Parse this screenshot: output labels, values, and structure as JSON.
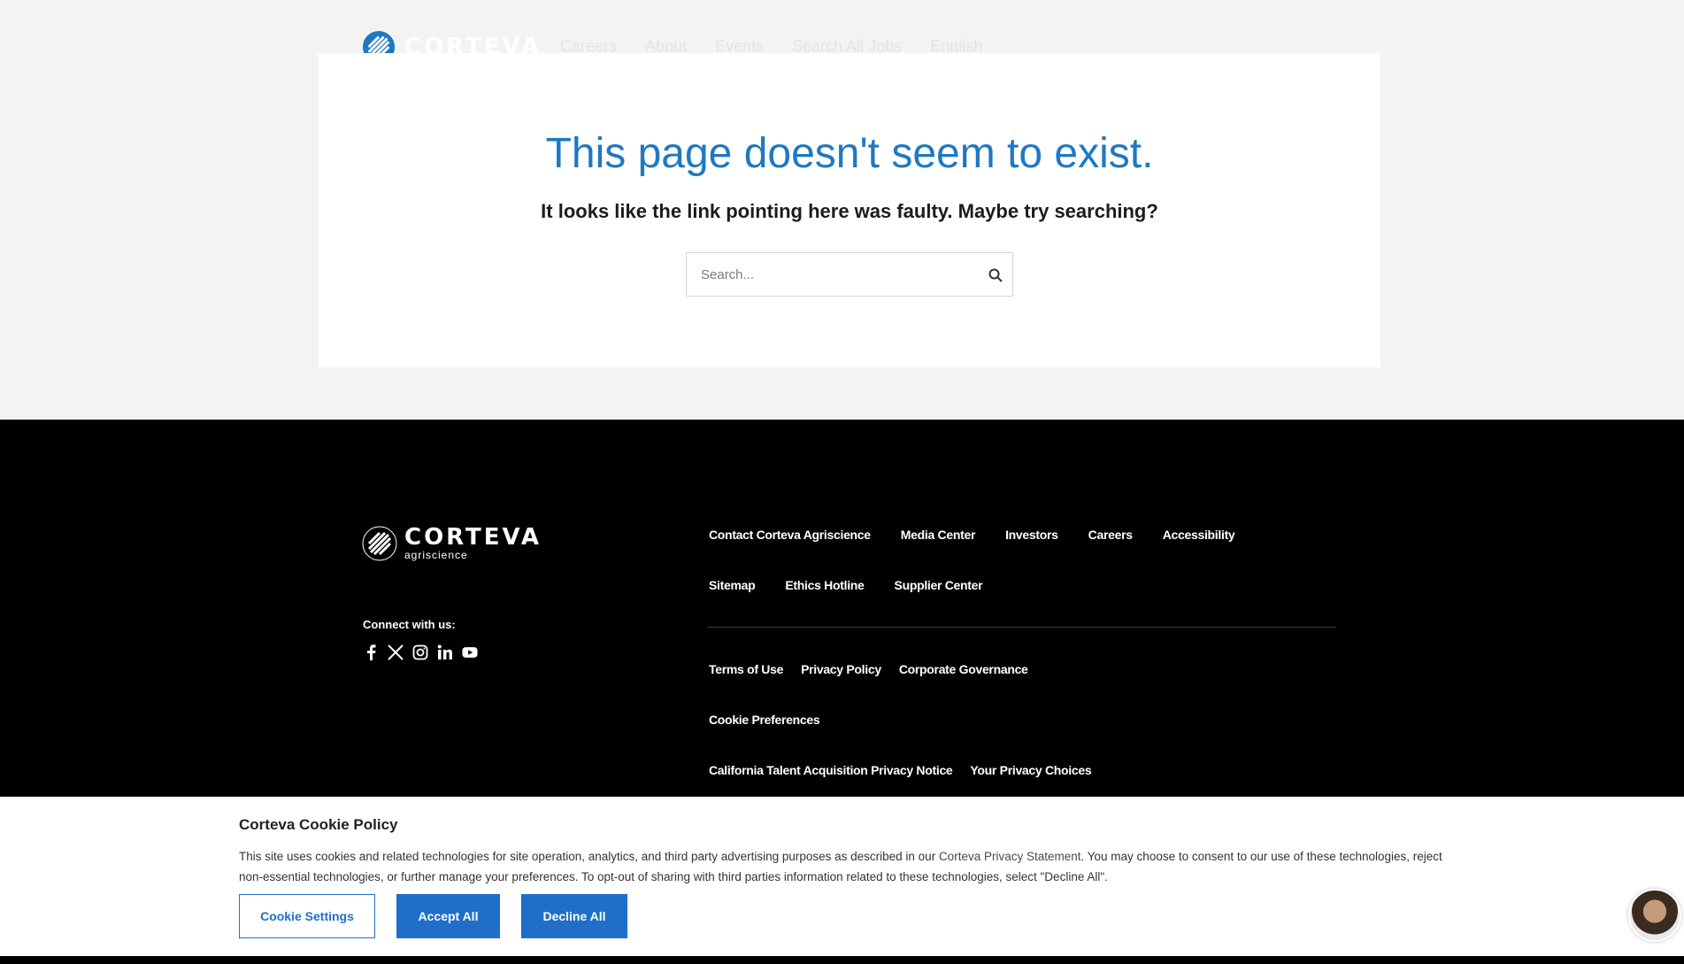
{
  "header": {
    "brand": "CORTEVA",
    "nav": [
      "Careers",
      "About",
      "Events",
      "Search All Jobs",
      "English"
    ]
  },
  "main": {
    "title": "This page doesn't seem to exist.",
    "subtitle": "It looks like the link pointing here was faulty. Maybe try searching?",
    "search": {
      "placeholder": "Search...",
      "value": ""
    }
  },
  "footer": {
    "brand": "CORTEVA",
    "brand_sub": "agriscience",
    "connect_label": "Connect with us:",
    "socials": [
      "facebook-icon",
      "x-icon",
      "instagram-icon",
      "linkedin-icon",
      "youtube-icon"
    ],
    "links_row1": [
      "Contact Corteva Agriscience",
      "Media Center",
      "Investors",
      "Careers",
      "Accessibility"
    ],
    "links_row2": [
      "Sitemap",
      "Ethics Hotline",
      "Supplier Center"
    ],
    "links_row3": [
      "Terms of Use",
      "Privacy Policy",
      "Corporate Governance"
    ],
    "links_row4": [
      "Cookie Preferences"
    ],
    "links_row5": [
      "California Talent Acquisition Privacy Notice",
      "Your Privacy Choices"
    ]
  },
  "cookie": {
    "title": "Corteva Cookie Policy",
    "text_before": "This site uses cookies and related technologies for site operation, analytics, and third party advertising purposes as described in our ",
    "link": "Corteva Privacy Statement",
    "text_after": ". You may choose to consent to our use of these technologies, reject non-essential technologies, or further manage your preferences. To opt-out of sharing with third parties information related to these technologies, select \"Decline All\".",
    "settings_label": "Cookie Settings",
    "accept_label": "Accept All",
    "decline_label": "Decline All"
  },
  "colors": {
    "accent": "#1f6fc9",
    "title_blue": "#1f78c1",
    "footer_bg": "#000000"
  }
}
